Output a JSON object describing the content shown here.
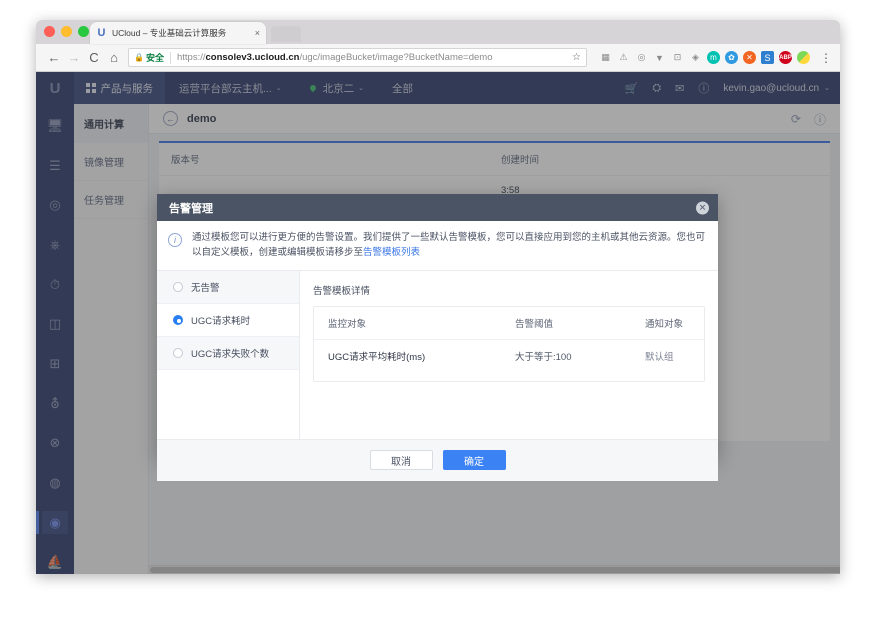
{
  "browser": {
    "tab": {
      "favicon": "ucloud-u-logo",
      "title": "UCloud – 专业基础云计算服务",
      "close": "×"
    },
    "toolbar": {
      "back": "←",
      "forward": "→",
      "reload": "C",
      "home": "⌂",
      "lock": "🔒",
      "secure_label": "安全",
      "url_prefix": "https://",
      "url_host": "consolev3.ucloud.cn",
      "url_path": "/ugc/imageBucket/image?BucketName=demo",
      "star": "☆",
      "menu": "⋮"
    },
    "extensions": [
      {
        "name": "puzzle-icon",
        "glyph": "▦"
      },
      {
        "name": "alert-icon",
        "glyph": "⚠"
      },
      {
        "name": "cast-icon",
        "glyph": "((•))"
      },
      {
        "name": "filter-icon",
        "glyph": "▼"
      },
      {
        "name": "frame-icon",
        "glyph": "⊡"
      },
      {
        "name": "droplet-icon",
        "glyph": "◈"
      },
      {
        "name": "teal-extension",
        "glyph": "m"
      },
      {
        "name": "blue-extension",
        "glyph": "✿"
      },
      {
        "name": "orange-extension",
        "glyph": "✕"
      },
      {
        "name": "s-extension",
        "glyph": "S"
      },
      {
        "name": "abp-extension",
        "glyph": "ABP"
      },
      {
        "name": "color-extension",
        "glyph": ""
      }
    ]
  },
  "app_nav": {
    "logo": "U",
    "products_label": "产品与服务",
    "project_label": "运营平台部云主机...",
    "region_label": "北京二",
    "scope_label": "全部",
    "icons": [
      {
        "name": "cart-icon",
        "glyph": "⛊"
      },
      {
        "name": "ticket-icon",
        "glyph": "⎙"
      },
      {
        "name": "mail-icon",
        "glyph": "✉"
      },
      {
        "name": "help-icon",
        "glyph": "?"
      }
    ],
    "user": "kevin.gao@ucloud.cn",
    "caret": "⌄"
  },
  "rail": [
    {
      "name": "monitor-icon",
      "glyph": "🖵",
      "active": false
    },
    {
      "name": "layers-icon",
      "glyph": "☰",
      "active": false
    },
    {
      "name": "disk-icon",
      "glyph": "◎",
      "active": false
    },
    {
      "name": "network-icon",
      "glyph": "⌬",
      "active": false
    },
    {
      "name": "clock-icon",
      "glyph": "⏱",
      "active": false
    },
    {
      "name": "database-icon",
      "glyph": "🗄",
      "active": false
    },
    {
      "name": "apps-icon",
      "glyph": "⊞",
      "active": false
    },
    {
      "name": "shield-icon",
      "glyph": "⛨",
      "active": false
    },
    {
      "name": "ban-icon",
      "glyph": "⊗",
      "active": false
    },
    {
      "name": "analytics-icon",
      "glyph": "◍",
      "active": false
    },
    {
      "name": "ugc-icon",
      "glyph": "◉",
      "active": true
    },
    {
      "name": "sail-icon",
      "glyph": "⛵",
      "active": false
    }
  ],
  "sidebar": {
    "title": "通用计算",
    "items": [
      {
        "label": "镜像管理"
      },
      {
        "label": "任务管理"
      }
    ]
  },
  "content": {
    "back_arrow": "←",
    "title": "demo",
    "actions": [
      {
        "name": "refresh-icon",
        "glyph": "⟳"
      },
      {
        "name": "help-icon",
        "glyph": "?"
      }
    ],
    "background_table": {
      "headers": [
        "版本号",
        "创建时间"
      ],
      "rows": [
        {
          "version": "",
          "created": "3:58"
        }
      ]
    }
  },
  "modal": {
    "title": "告警管理",
    "close": "✕",
    "notice": {
      "icon": "info-icon",
      "text_before_link": "通过模板您可以进行更方便的告警设置。我们提供了一些默认告警模板，您可以直接应用到您的主机或其他云资源。您也可以自定义模板，创建或编辑模板请移步至",
      "link_text": "告警模板列表"
    },
    "radio_options": [
      {
        "label": "无告警",
        "selected": false
      },
      {
        "label": "UGC请求耗时",
        "selected": true
      },
      {
        "label": "UGC请求失败个数",
        "selected": false
      }
    ],
    "detail": {
      "title": "告警模板详情",
      "headers": [
        "监控对象",
        "告警阈值",
        "通知对象"
      ],
      "rows": [
        {
          "target": "UGC请求平均耗时(ms)",
          "threshold": "大于等于:100",
          "notify": "默认组"
        }
      ]
    },
    "footer": {
      "cancel_label": "取消",
      "confirm_label": "确定"
    }
  },
  "colors": {
    "brand_navy": "#2c3a6b",
    "primary_blue": "#3b82f5",
    "modal_header": "#4b5464",
    "link_blue": "#3b76e8",
    "secure_green": "#0b8043"
  }
}
